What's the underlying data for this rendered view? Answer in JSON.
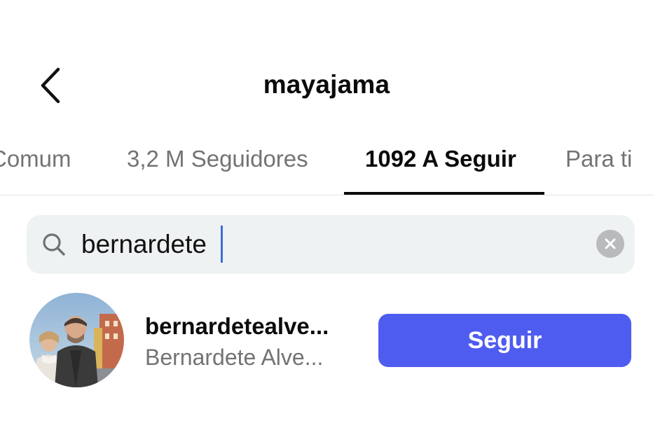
{
  "header": {
    "title": "mayajama",
    "back_icon": "chevron-left-icon"
  },
  "tabs": [
    {
      "label": "Comum",
      "active": false
    },
    {
      "label": "3,2 M Seguidores",
      "active": false
    },
    {
      "label": "1092 A Seguir",
      "active": true
    },
    {
      "label": "Para ti",
      "active": false
    }
  ],
  "search": {
    "value": "bernardete",
    "icon": "search-icon",
    "clear_icon": "close-icon"
  },
  "results": [
    {
      "username": "bernardetealve...",
      "full_name": "Bernardete Alve...",
      "button_label": "Seguir"
    }
  ],
  "colors": {
    "accent": "#4f5cf0",
    "search_bg": "#eff2f3",
    "muted_text": "#737373"
  }
}
